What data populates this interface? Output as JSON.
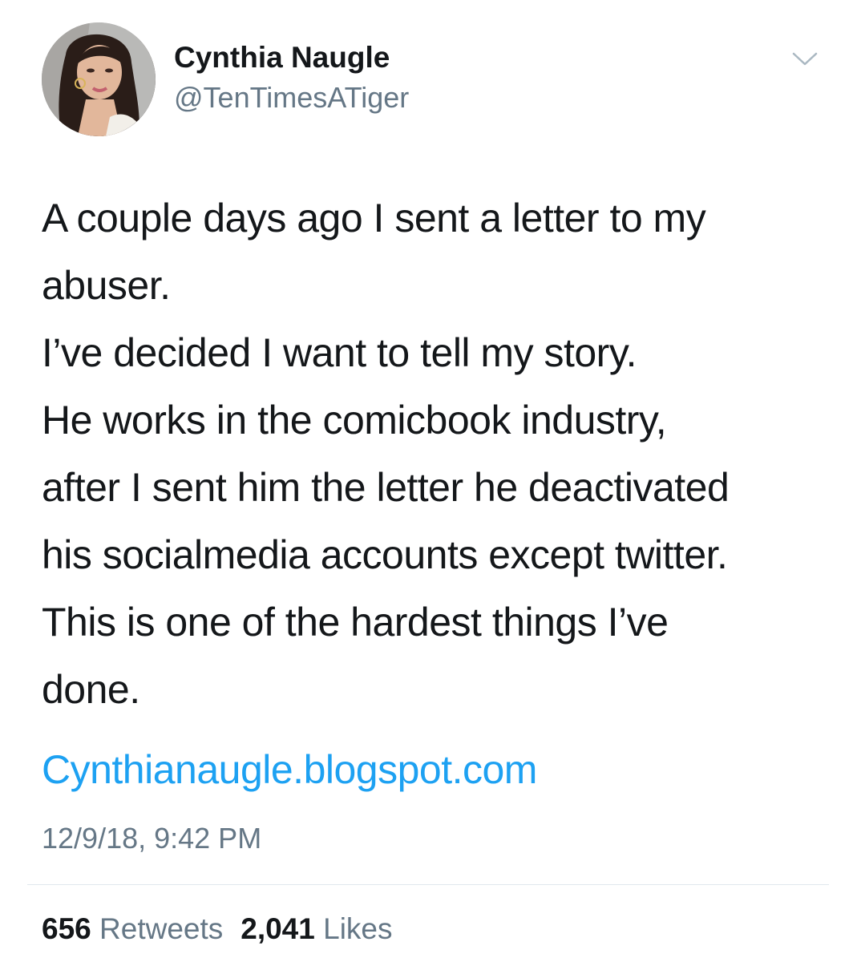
{
  "author": {
    "display_name": "Cynthia Naugle",
    "handle": "@TenTimesATiger",
    "avatar_icon": "profile-photo"
  },
  "menu": {
    "icon": "chevron-down-icon"
  },
  "tweet": {
    "lines": [
      "A couple days ago I sent a letter to my",
      "abuser.",
      "I’ve decided I want to tell my story.",
      "He works in the comicbook industry,",
      "after I sent him the letter he deactivated",
      "his socialmedia accounts except twitter.",
      "This is one of the hardest things I’ve",
      "done."
    ],
    "link": "Cynthianaugle.blogspot.com",
    "timestamp": "12/9/18, 9:42 PM"
  },
  "stats": {
    "retweets_count": "656",
    "retweets_label": "Retweets",
    "likes_count": "2,041",
    "likes_label": "Likes"
  },
  "colors": {
    "text": "#14171a",
    "secondary": "#657786",
    "link": "#1da1f2",
    "divider": "#e1e8ed"
  }
}
